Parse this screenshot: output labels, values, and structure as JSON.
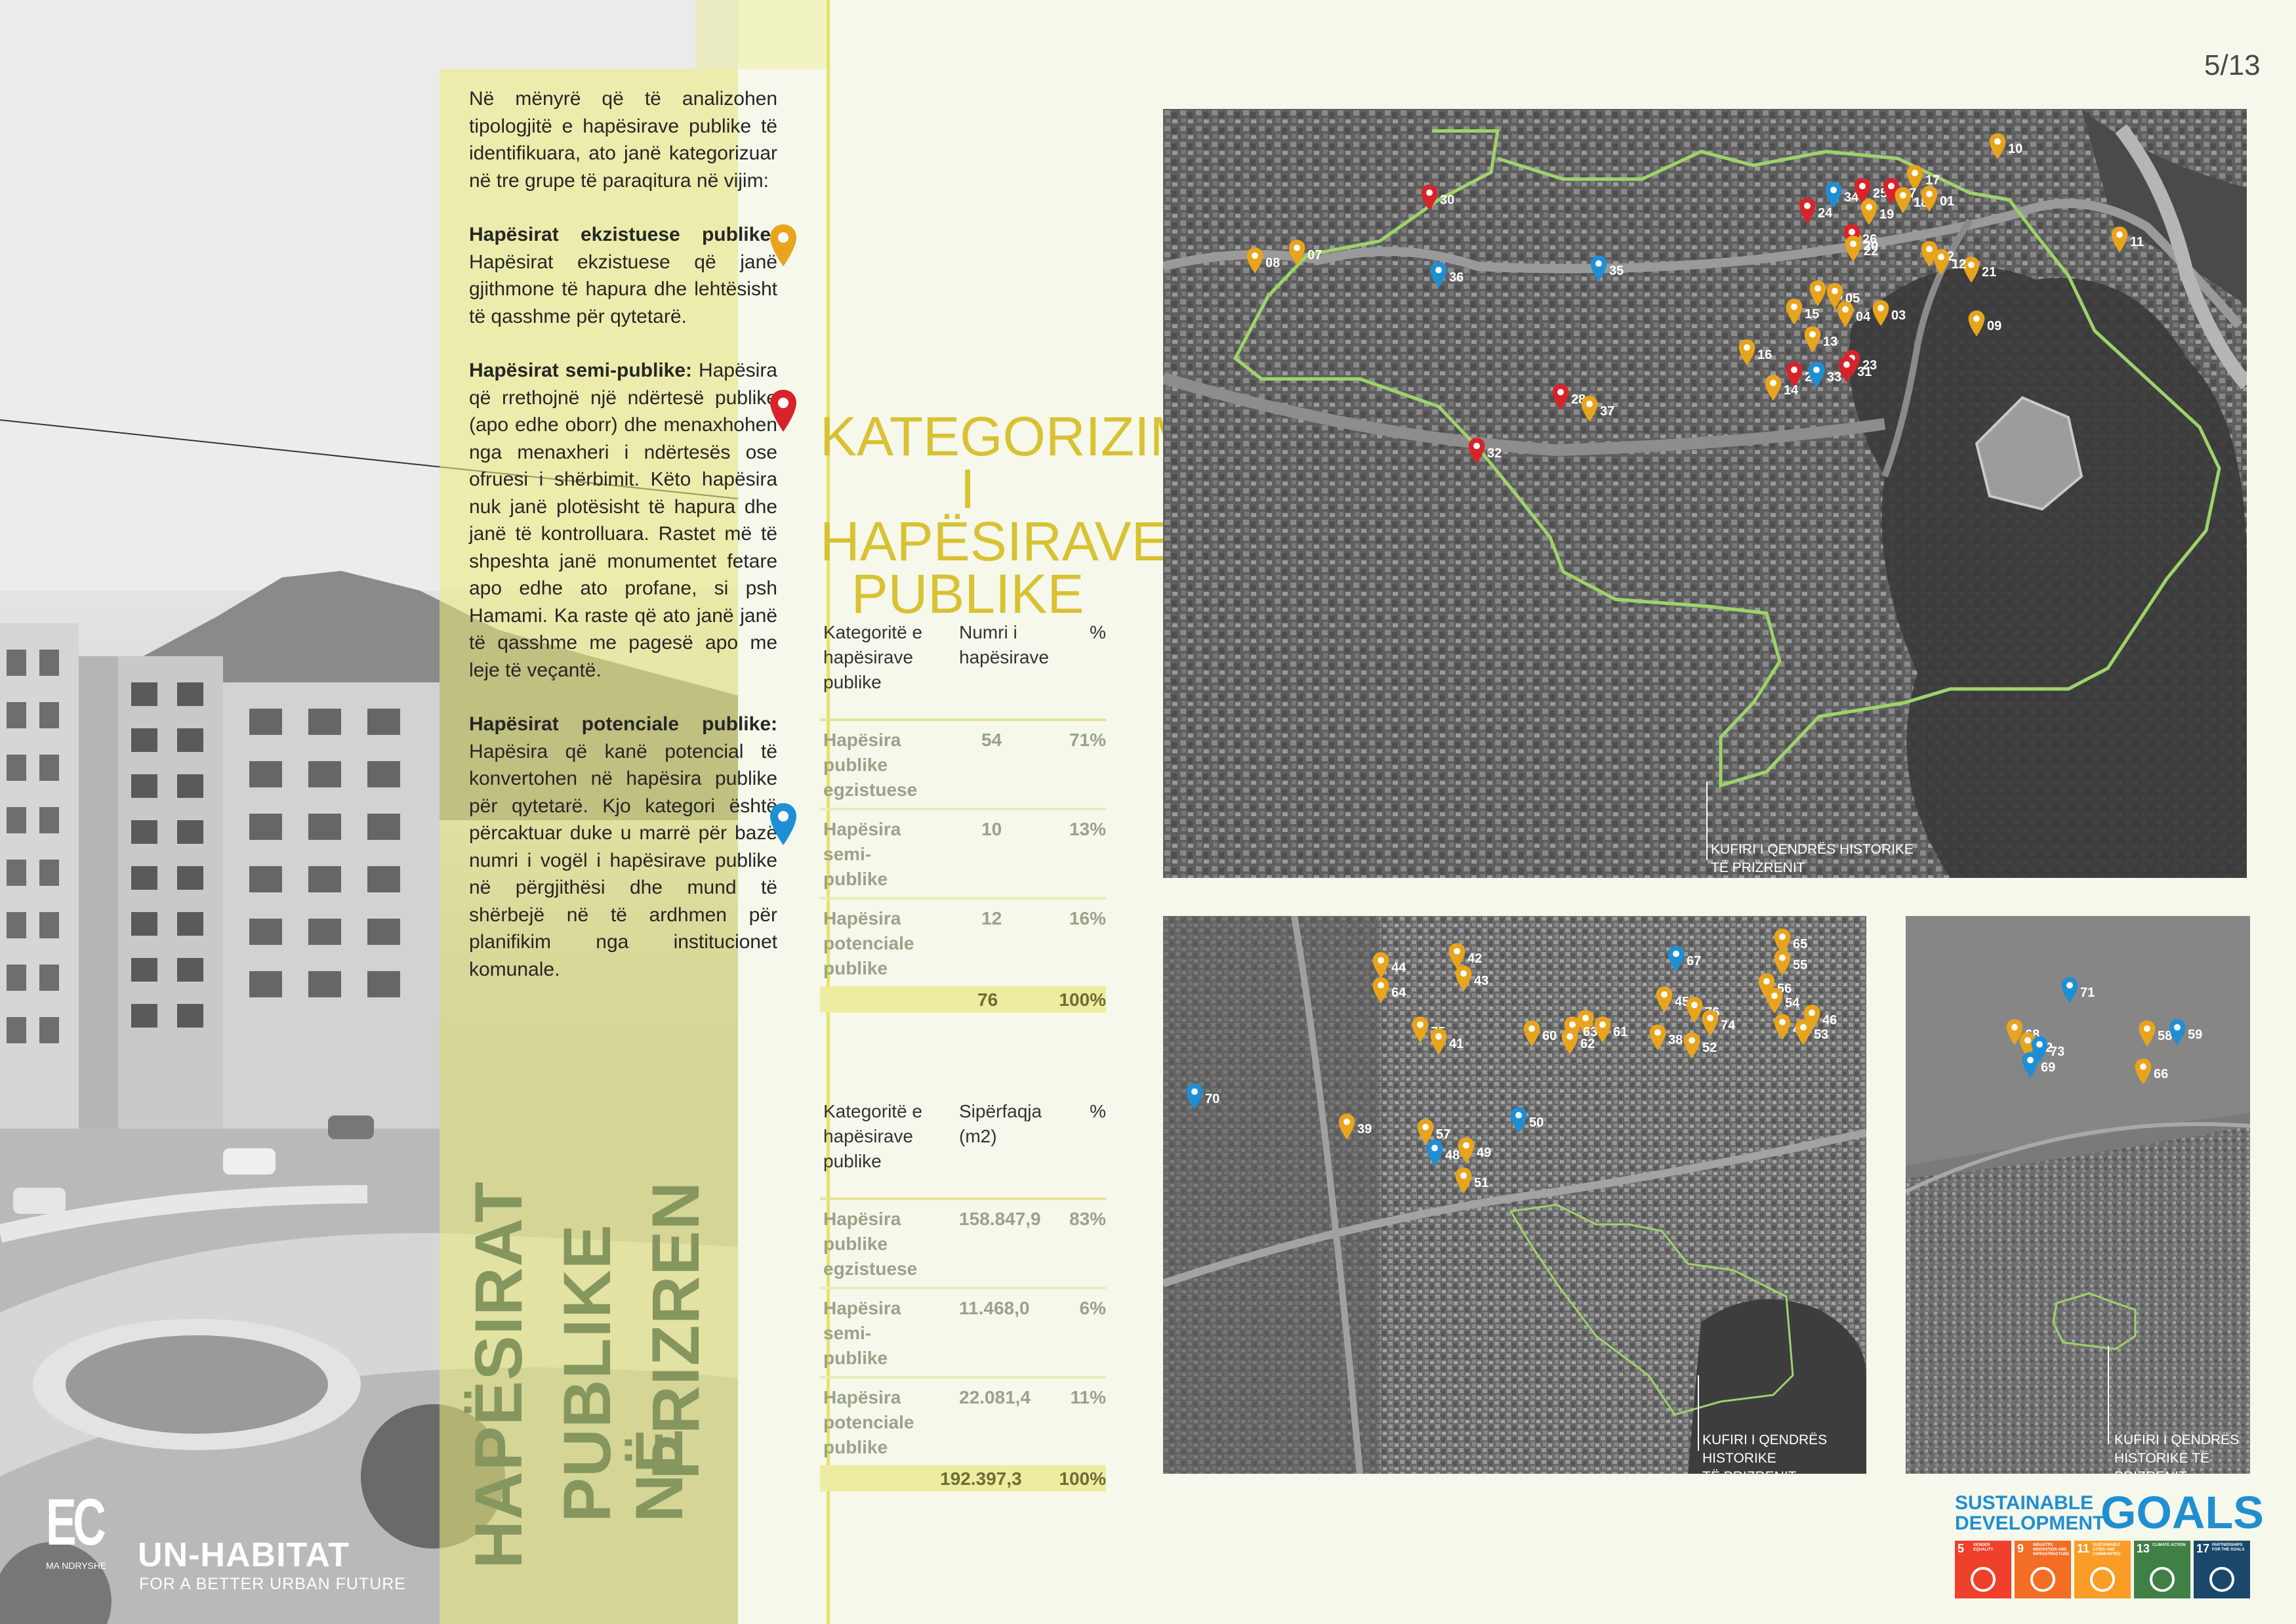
{
  "page_number": "5/13",
  "intro": {
    "lead": "Në mënyrë që të analizohen tipologjitë e hapësirave publike të identifikuara, ato janë kategorizuar në tre grupe të paraqitura në vijim:",
    "existing_title": "Hapësirat ekzistuese publike:",
    "existing_text": "Hapësirat ekzistuese që janë gjithmone të hapura dhe lehtësisht të qasshme për qytetarë.",
    "semi_title": "Hapësirat semi-publike:",
    "semi_text": "Hapësira që rrethojnë një ndërtesë publike (apo edhe oborr) dhe menaxhohen nga menaxheri i ndërtesës ose ofruesi i shërbimit. Këto hapësira nuk janë plotësisht të hapura dhe janë të kontrolluara. Rastet më të shpeshta janë monumentet fetare apo edhe ato profane, si psh Hamami. Ka raste që ato janë janë të qasshme me pagesë apo me leje të veçantë.",
    "potential_title": "Hapësirat potenciale publike:",
    "potential_text": "Hapësira që kanë potencial të konvertohen në hapësira publike për qytetarë. Kjo kategori është përcaktuar duke u marrë për bazë numri i vogël i hapësirave publike në përgjithësi dhe mund të shërbejë në të ardhmen për planifikim nga institucionet komunale."
  },
  "vertical_title": [
    "HAPËSIRAT",
    "PUBLIKE NË",
    "PRIZREN"
  ],
  "logos": {
    "ec": "EC",
    "ec_sub": "MA NDRYSHE",
    "unhabitat": "UN-HABITAT",
    "unhabitat_tagline": "FOR A BETTER URBAN FUTURE"
  },
  "category_title": [
    "KATEGORIZIMI",
    "I HAPËSIRAVE",
    "PUBLIKE"
  ],
  "table_count": {
    "headers": [
      "Kategoritë e hapësirave publike",
      "Numri i hapësirave",
      "%"
    ],
    "rows": [
      {
        "label": "Hapësira publike egzistuese",
        "value": "54",
        "pct": "71%"
      },
      {
        "label": "Hapësira semi-publike",
        "value": "10",
        "pct": "13%"
      },
      {
        "label": "Hapësira potenciale publike",
        "value": "12",
        "pct": "16%"
      }
    ],
    "total": {
      "value": "76",
      "pct": "100%"
    }
  },
  "table_area": {
    "headers": [
      "Kategoritë e hapësirave publike",
      "Sipërfaqja (m2)",
      "%"
    ],
    "rows": [
      {
        "label": "Hapësira publike egzistuese",
        "value": "158.847,9",
        "pct": "83%"
      },
      {
        "label": "Hapësira semi-publike",
        "value": "11.468,0",
        "pct": "6%"
      },
      {
        "label": "Hapësira potenciale publike",
        "value": "22.081,4",
        "pct": "11%"
      }
    ],
    "total": {
      "value": "192.397,3",
      "pct": "100%"
    }
  },
  "legend_colors": {
    "existing": "#e8a41c",
    "semi": "#d8232a",
    "potential": "#1e8fd5",
    "boundary": "#9ed36a"
  },
  "map_labels": {
    "main": [
      "KUFIRI I QENDRËS HISTORIKE",
      "TË PRIZRENIT"
    ],
    "mid": [
      "KUFIRI I QENDRËS HISTORIKE",
      "TË PRIZRENIT"
    ],
    "small": [
      "KUFIRI I QENDRËS",
      "HISTORIKE TË PRIZRENIT"
    ]
  },
  "markers_main": [
    {
      "n": "10",
      "c": "o"
    },
    {
      "n": "17",
      "c": "o"
    },
    {
      "n": "34",
      "c": "b"
    },
    {
      "n": "25",
      "c": "r"
    },
    {
      "n": "27",
      "c": "r"
    },
    {
      "n": "18",
      "c": "o"
    },
    {
      "n": "01",
      "c": "o"
    },
    {
      "n": "30",
      "c": "r"
    },
    {
      "n": "24",
      "c": "r"
    },
    {
      "n": "19",
      "c": "o"
    },
    {
      "n": "11",
      "c": "o"
    },
    {
      "n": "20",
      "c": "o"
    },
    {
      "n": "26",
      "c": "r"
    },
    {
      "n": "22",
      "c": "o"
    },
    {
      "n": "02",
      "c": "o"
    },
    {
      "n": "08",
      "c": "o"
    },
    {
      "n": "07",
      "c": "o"
    },
    {
      "n": "21",
      "c": "o"
    },
    {
      "n": "12",
      "c": "o"
    },
    {
      "n": "35",
      "c": "b"
    },
    {
      "n": "36",
      "c": "b"
    },
    {
      "n": "06",
      "c": "o"
    },
    {
      "n": "05",
      "c": "o"
    },
    {
      "n": "15",
      "c": "o"
    },
    {
      "n": "04",
      "c": "o"
    },
    {
      "n": "03",
      "c": "o"
    },
    {
      "n": "09",
      "c": "o"
    },
    {
      "n": "13",
      "c": "o"
    },
    {
      "n": "16",
      "c": "o"
    },
    {
      "n": "23",
      "c": "r"
    },
    {
      "n": "29",
      "c": "r"
    },
    {
      "n": "33",
      "c": "b"
    },
    {
      "n": "31",
      "c": "r"
    },
    {
      "n": "14",
      "c": "o"
    },
    {
      "n": "28",
      "c": "r"
    },
    {
      "n": "37",
      "c": "o"
    },
    {
      "n": "32",
      "c": "r"
    }
  ],
  "markers_mid": [
    {
      "n": "65",
      "c": "o"
    },
    {
      "n": "42",
      "c": "o"
    },
    {
      "n": "67",
      "c": "b"
    },
    {
      "n": "55",
      "c": "o"
    },
    {
      "n": "44",
      "c": "o"
    },
    {
      "n": "43",
      "c": "o"
    },
    {
      "n": "64",
      "c": "o"
    },
    {
      "n": "56",
      "c": "o"
    },
    {
      "n": "45",
      "c": "o"
    },
    {
      "n": "54",
      "c": "o"
    },
    {
      "n": "76",
      "c": "o"
    },
    {
      "n": "46",
      "c": "o"
    },
    {
      "n": "74",
      "c": "o"
    },
    {
      "n": "47",
      "c": "o"
    },
    {
      "n": "53",
      "c": "o"
    },
    {
      "n": "40",
      "c": "o"
    },
    {
      "n": "63",
      "c": "o"
    },
    {
      "n": "61",
      "c": "o"
    },
    {
      "n": "75",
      "c": "o"
    },
    {
      "n": "60",
      "c": "o"
    },
    {
      "n": "38",
      "c": "o"
    },
    {
      "n": "41",
      "c": "o"
    },
    {
      "n": "62",
      "c": "o"
    },
    {
      "n": "52",
      "c": "o"
    },
    {
      "n": "70",
      "c": "b"
    },
    {
      "n": "50",
      "c": "b"
    },
    {
      "n": "39",
      "c": "o"
    },
    {
      "n": "57",
      "c": "o"
    },
    {
      "n": "48",
      "c": "b"
    },
    {
      "n": "49",
      "c": "o"
    },
    {
      "n": "51",
      "c": "o"
    }
  ],
  "markers_small": [
    {
      "n": "71",
      "c": "b"
    },
    {
      "n": "68",
      "c": "o"
    },
    {
      "n": "58",
      "c": "o"
    },
    {
      "n": "59",
      "c": "b"
    },
    {
      "n": "72",
      "c": "o"
    },
    {
      "n": "73",
      "c": "b"
    },
    {
      "n": "69",
      "c": "b"
    },
    {
      "n": "66",
      "c": "o"
    }
  ],
  "sdg": {
    "title_line1": "SUSTAINABLE",
    "title_line2": "DEVELOPMENT",
    "goals_word": "GOALS",
    "goals": [
      {
        "num": "5",
        "label": "GENDER EQUALITY",
        "color": "#ef402b"
      },
      {
        "num": "9",
        "label": "INDUSTRY, INNOVATION AND INFRASTRUCTURE",
        "color": "#f36d25"
      },
      {
        "num": "11",
        "label": "SUSTAINABLE CITIES AND COMMUNITIES",
        "color": "#f99d26"
      },
      {
        "num": "13",
        "label": "CLIMATE ACTION",
        "color": "#407f46"
      },
      {
        "num": "17",
        "label": "PARTNERSHIPS FOR THE GOALS",
        "color": "#19486a"
      }
    ]
  }
}
